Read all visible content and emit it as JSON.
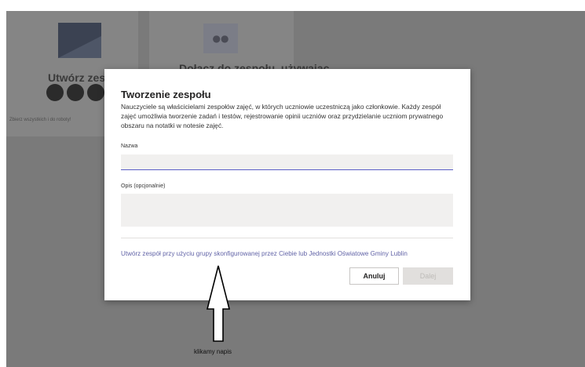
{
  "background": {
    "card_create": {
      "title": "Utwórz zespół",
      "subtitle": "Zbierz wszystkich i do roboty!"
    },
    "card_join": {
      "title": "Dołącz do zespołu, używając"
    }
  },
  "dialog": {
    "title": "Tworzenie zespołu",
    "description": "Nauczyciele są właścicielami zespołów zajęć, w których uczniowie uczestniczą jako członkowie. Każdy zespół zajęć umożliwia tworzenie zadań i testów, rejestrowanie opinii uczniów oraz przydzielanie uczniom prywatnego obszaru na notatki w notesie zajęć.",
    "name_label": "Nazwa",
    "name_value": "",
    "description_label": "Opis (opcjonalnie)",
    "description_value": "",
    "group_link": "Utwórz zespół przy użyciu grupy skonfigurowanej przez Ciebie lub Jednostki Oświatowe Gminy Lublin",
    "cancel_label": "Anuluj",
    "next_label": "Dalej"
  },
  "annotation": {
    "caption": "klikamy napis"
  },
  "colors": {
    "accent": "#6264a7",
    "overlay": "#7a7a7a"
  }
}
